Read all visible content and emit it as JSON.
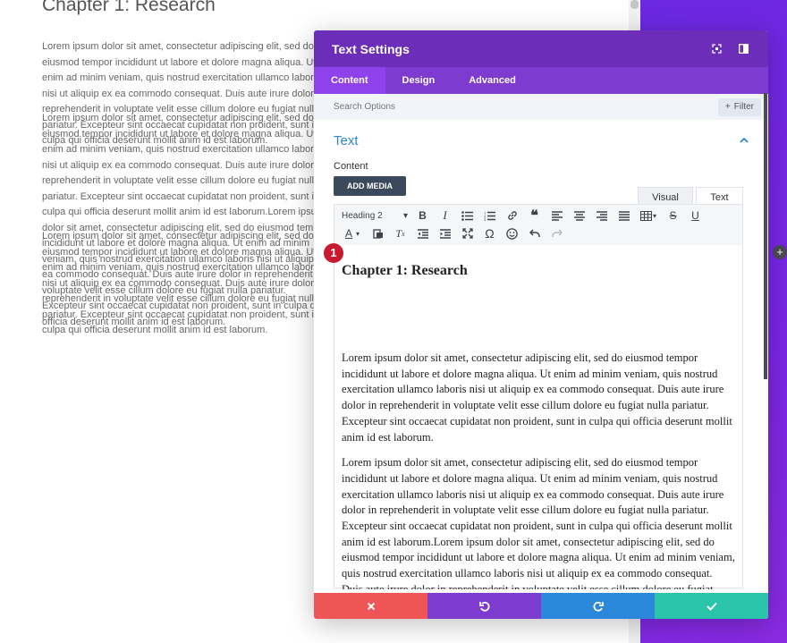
{
  "page": {
    "title": "Chapter 1: Research",
    "paragraphs": [
      "Lorem ipsum dolor sit amet, consectetur adipiscing elit, sed do eiusmod tempor incididunt ut labore et dolore magna aliqua. Ut enim ad minim veniam, quis nostrud exercitation ullamco laboris nisi ut aliquip ex ea commodo consequat. Duis aute irure dolor in reprehenderit in voluptate velit esse cillum dolore eu fugiat nulla pariatur. Excepteur sint occaecat cupidatat non proident, sunt in culpa qui officia deserunt mollit anim id est laborum.",
      "Lorem ipsum dolor sit amet, consectetur adipiscing elit, sed do eiusmod tempor incididunt ut labore et dolore magna aliqua. Ut enim ad minim veniam, quis nostrud exercitation ullamco laboris nisi ut aliquip ex ea commodo consequat. Duis aute irure dolor in reprehenderit in voluptate velit esse cillum dolore eu fugiat nulla pariatur. Excepteur sint occaecat cupidatat non proident, sunt in culpa qui officia deserunt mollit anim id est laborum.Lorem ipsum dolor sit amet, consectetur adipiscing elit, sed do eiusmod tempor incididunt ut labore et dolore magna aliqua. Ut enim ad minim veniam, quis nostrud exercitation ullamco laboris nisi ut aliquip ex ea commodo consequat. Duis aute irure dolor in reprehenderit in voluptate velit esse cillum dolore eu fugiat nulla pariatur. Excepteur sint occaecat cupidatat non proident, sunt in culpa qui officia deserunt mollit anim id est laborum.",
      "Lorem ipsum dolor sit amet, consectetur adipiscing elit, sed do eiusmod tempor incididunt ut labore et dolore magna aliqua. Ut enim ad minim veniam, quis nostrud exercitation ullamco laboris nisi ut aliquip ex ea commodo consequat. Duis aute irure dolor in reprehenderit in voluptate velit esse cillum dolore eu fugiat nulla pariatur. Excepteur sint occaecat cupidatat non proident, sunt in culpa qui officia deserunt mollit anim id est laborum."
    ]
  },
  "modal": {
    "title": "Text Settings",
    "tabs": [
      "Content",
      "Design",
      "Advanced"
    ],
    "search_placeholder": "Search Options",
    "filter_label": "Filter",
    "section_title": "Text",
    "content_label": "Content",
    "add_media_label": "ADD MEDIA",
    "editor_tabs": {
      "visual": "Visual",
      "text": "Text"
    },
    "format_select": "Heading 2",
    "badge_number": "1",
    "editor_content": {
      "heading": "Chapter 1: Research",
      "paragraphs": [
        "Lorem ipsum dolor sit amet, consectetur adipiscing elit, sed do eiusmod tempor incididunt ut labore et dolore magna aliqua. Ut enim ad minim veniam, quis nostrud exercitation ullamco laboris nisi ut aliquip ex ea commodo consequat. Duis aute irure dolor in reprehenderit in voluptate velit esse cillum dolore eu fugiat nulla pariatur. Excepteur sint occaecat cupidatat non proident, sunt in culpa qui officia deserunt mollit anim id est laborum.",
        "Lorem ipsum dolor sit amet, consectetur adipiscing elit, sed do eiusmod tempor incididunt ut labore et dolore magna aliqua. Ut enim ad minim veniam, quis nostrud exercitation ullamco laboris nisi ut aliquip ex ea commodo consequat. Duis aute irure dolor in reprehenderit in voluptate velit esse cillum dolore eu fugiat nulla pariatur. Excepteur sint occaecat cupidatat non proident, sunt in culpa qui officia deserunt mollit anim id est laborum.Lorem ipsum dolor sit amet, consectetur adipiscing elit, sed do eiusmod tempor incididunt ut labore et dolore magna aliqua. Ut enim ad minim veniam, quis nostrud exercitation ullamco laboris nisi ut aliquip ex ea commodo consequat. Duis aute irure dolor in reprehenderit in voluptate velit esse cillum dolore eu fugiat nulla pariatur."
      ]
    },
    "footer_colors": {
      "cancel": "#ef5555",
      "undo": "#7e3bd0",
      "redo": "#2b87da",
      "save": "#29c4a9"
    }
  },
  "colors": {
    "header": "#6c2eb9",
    "tabs_bar": "#7e3bd0",
    "active_tab": "#8f42ec",
    "accent_blue": "#2b87da",
    "badge": "#c8192f",
    "band": "#7b26e6"
  }
}
